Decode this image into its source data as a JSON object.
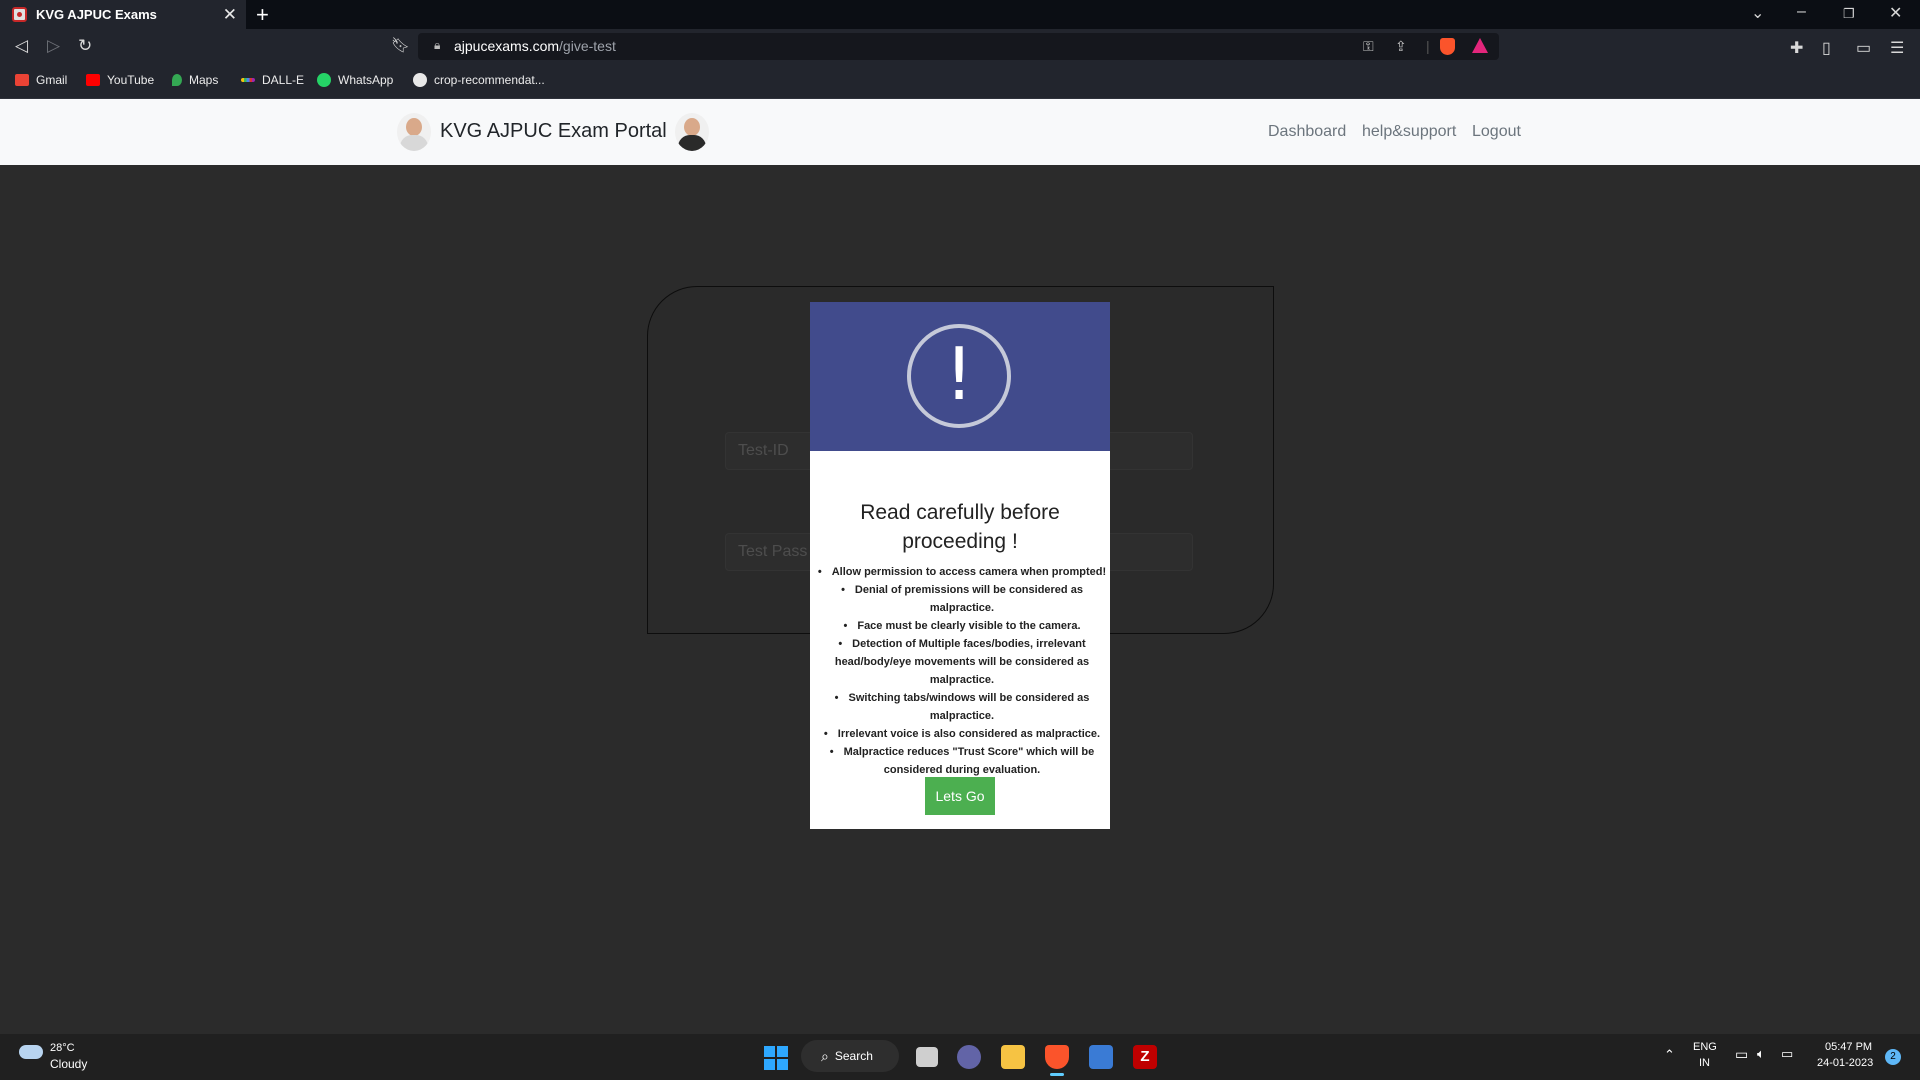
{
  "browser": {
    "tab_title": "KVG AJPUC Exams",
    "tab_close": "✕",
    "new_tab": "+",
    "url_host": "ajpucexams.com",
    "url_path": "/give-test",
    "bookmarks": [
      "Gmail",
      "YouTube",
      "Maps",
      "DALL-E",
      "WhatsApp",
      "crop-recommendat..."
    ]
  },
  "site": {
    "brand": "KVG AJPUC Exam Portal",
    "nav": [
      "Dashboard",
      "help&support",
      "Logout"
    ]
  },
  "form": {
    "test_id_placeholder": "Test-ID",
    "test_pass_placeholder": "Test Pass"
  },
  "modal": {
    "icon_glyph": "!",
    "title": "Read carefully before proceeding !",
    "rules": [
      "Allow permission to access camera when prompted!",
      "Denial of premissions will be considered as malpractice.",
      "Face must be clearly visible to the camera.",
      "Detection of Multiple faces/bodies, irrelevant head/body/eye movements will be considered as malpractice.",
      "Switching tabs/windows will be considered as malpractice.",
      "Irrelevant voice is also considered as malpractice.",
      "Malpractice reduces \"Trust Score\" which will be considered during evaluation."
    ],
    "button": "Lets Go",
    "header_color": "#414b8c",
    "button_color": "#4caf50"
  },
  "taskbar": {
    "temp": "28°C",
    "weather": "Cloudy",
    "search": "Search",
    "lang_top": "ENG",
    "lang_bottom": "IN",
    "time": "05:47 PM",
    "date": "24-01-2023",
    "notifications": "2"
  }
}
